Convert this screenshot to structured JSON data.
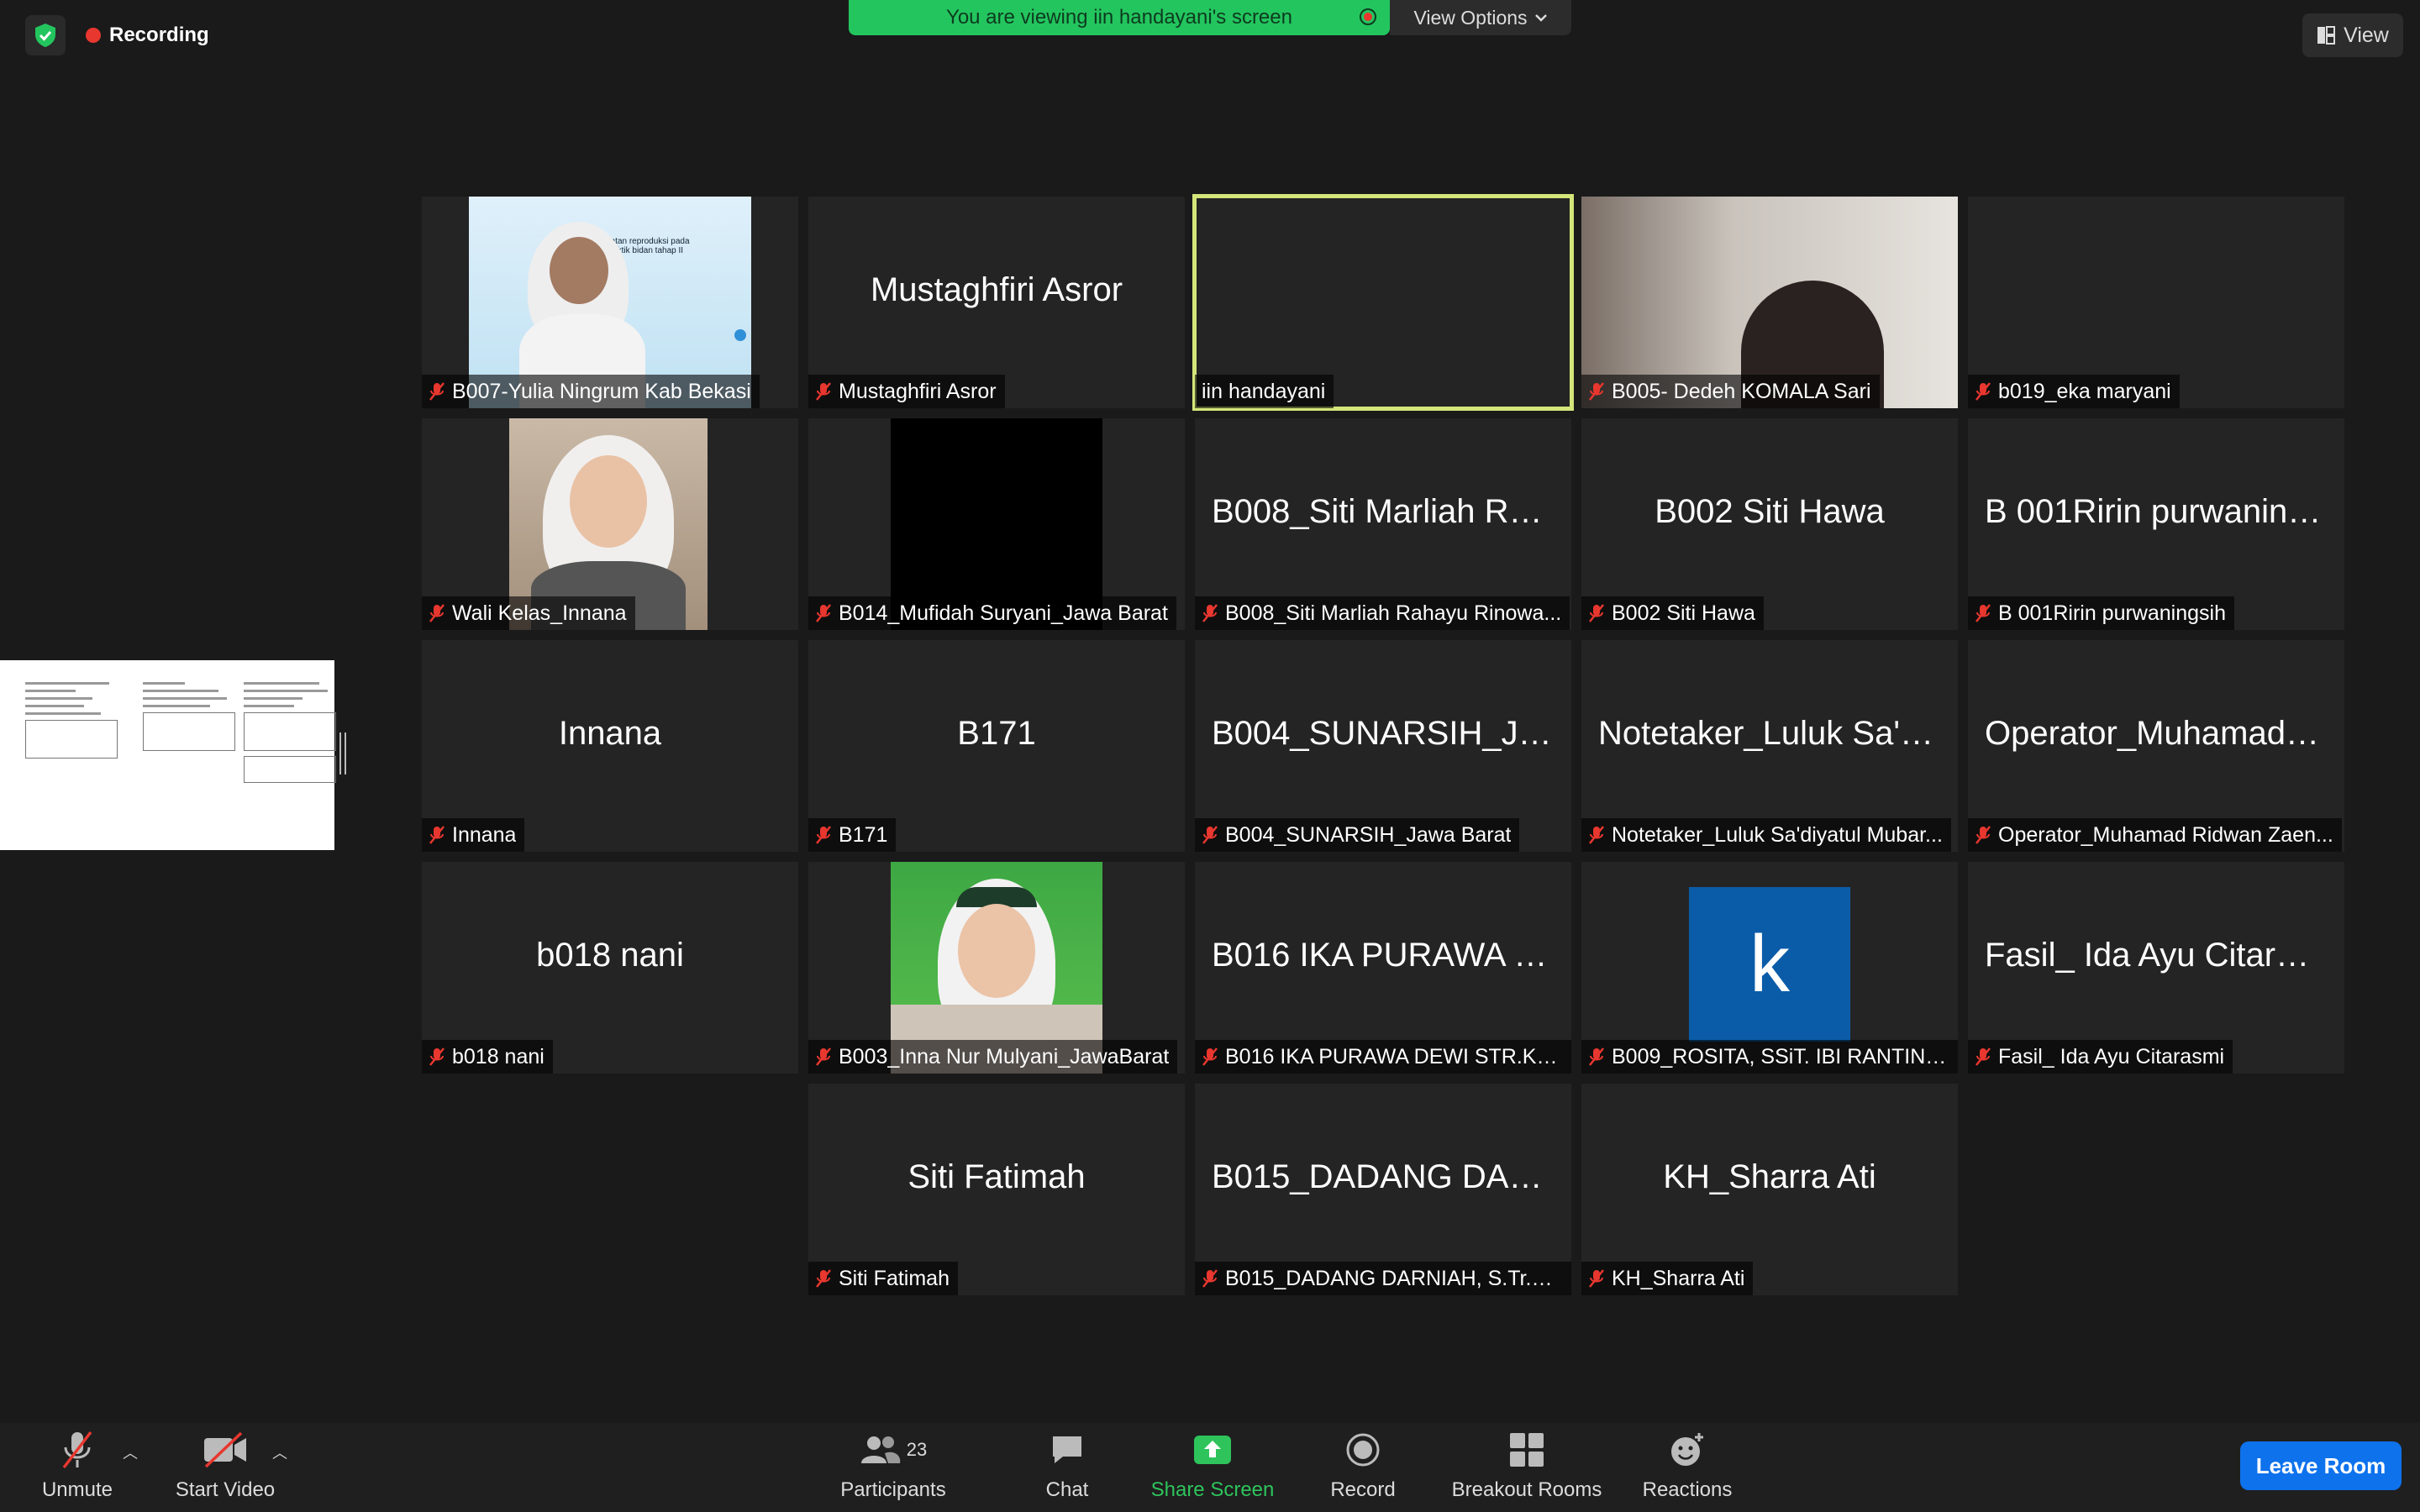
{
  "top": {
    "recording_label": "Recording",
    "banner_text": "You are viewing iin handayani's screen",
    "view_options_label": "View Options",
    "view_label": "View"
  },
  "tiles": [
    {
      "big": "",
      "label": "B007-Yulia Ningrum Kab Bekasi"
    },
    {
      "big": "Mustaghfiri Asror",
      "label": "Mustaghfiri Asror"
    },
    {
      "big": "",
      "label": "iin handayani"
    },
    {
      "big": "",
      "label": "B005- Dedeh KOMALA Sari"
    },
    {
      "big": "",
      "label": "b019_eka maryani"
    },
    {
      "big": "",
      "label": "Wali Kelas_Innana"
    },
    {
      "big": "",
      "label": "B014_Mufidah Suryani_Jawa Barat"
    },
    {
      "big": "B008_Siti Marliah Ra...",
      "label": "B008_Siti Marliah Rahayu Rinowa..."
    },
    {
      "big": "B002 Siti Hawa",
      "label": "B002 Siti Hawa"
    },
    {
      "big": "B 001Ririn purwaning...",
      "label": "B 001Ririn purwaningsih"
    },
    {
      "big": "Innana",
      "label": "Innana"
    },
    {
      "big": "B171",
      "label": "B171"
    },
    {
      "big": "B004_SUNARSIH_Ja...",
      "label": "B004_SUNARSIH_Jawa Barat"
    },
    {
      "big": "Notetaker_Luluk Sa'di...",
      "label": "Notetaker_Luluk Sa'diyatul Mubar..."
    },
    {
      "big": "Operator_Muhamad R...",
      "label": "Operator_Muhamad Ridwan Zaen..."
    },
    {
      "big": "b018 nani",
      "label": "b018 nani"
    },
    {
      "big": "",
      "label": "B003_Inna Nur Mulyani_JawaBarat"
    },
    {
      "big": "B016 IKA PURAWA D...",
      "label": "B016 IKA PURAWA DEWI STR.KE..."
    },
    {
      "big": "k",
      "label": "B009_ROSITA, SSiT. IBI RANTING..."
    },
    {
      "big": "Fasil_ Ida Ayu Citarasmi",
      "label": "Fasil_ Ida Ayu Citarasmi"
    },
    {
      "big": "Siti Fatimah",
      "label": "Siti Fatimah"
    },
    {
      "big": "B015_DADANG DAR...",
      "label": "B015_DADANG DARNIAH, S.Tr.Keb"
    },
    {
      "big": "KH_Sharra Ati",
      "label": "KH_Sharra Ati"
    }
  ],
  "slide": {
    "text": "Pelatihan kesehatan reproduksi pada pembimbing praktik bidan tahap II"
  },
  "toolbar": {
    "unmute": "Unmute",
    "start_video": "Start Video",
    "participants": "Participants",
    "participant_count": "23",
    "chat": "Chat",
    "share_screen": "Share Screen",
    "record": "Record",
    "breakout_rooms": "Breakout Rooms",
    "reactions": "Reactions",
    "leave_room": "Leave Room"
  },
  "colors": {
    "banner": "#23c55e",
    "active_speaker_border": "#d4e57a",
    "leave_button": "#0e72ed",
    "share_screen": "#2ec45b",
    "muted_mic": "#e8372f"
  }
}
